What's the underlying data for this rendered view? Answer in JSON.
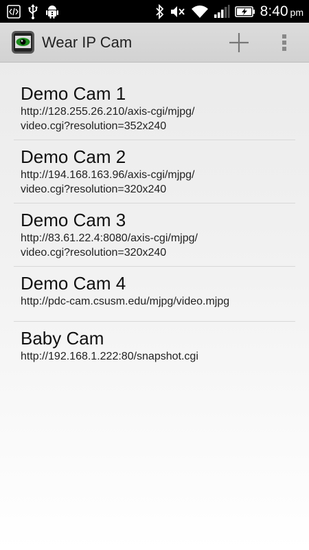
{
  "status_bar": {
    "time": "8:40",
    "ampm": "pm",
    "left_icons": [
      "code-icon",
      "usb-icon",
      "android-debug-icon"
    ],
    "right_icons": [
      "bluetooth-icon",
      "mute-icon",
      "wifi-icon",
      "signal-icon",
      "battery-charging-icon"
    ]
  },
  "action_bar": {
    "title": "Wear IP Cam",
    "add_icon": "plus-icon",
    "overflow_icon": "overflow-menu-icon"
  },
  "cameras": [
    {
      "name": "Demo Cam 1",
      "url": "http://128.255.26.210/axis-cgi/mjpg/\nvideo.cgi?resolution=352x240"
    },
    {
      "name": "Demo Cam 2",
      "url": "http://194.168.163.96/axis-cgi/mjpg/\nvideo.cgi?resolution=320x240"
    },
    {
      "name": "Demo Cam 3",
      "url": "http://83.61.22.4:8080/axis-cgi/mjpg/\nvideo.cgi?resolution=320x240"
    },
    {
      "name": "Demo Cam 4",
      "url": "http://pdc-cam.csusm.edu/mjpg/video.mjpg"
    },
    {
      "name": "Baby Cam",
      "url": "http://192.168.1.222:80/snapshot.cgi"
    }
  ],
  "colors": {
    "status_bar_bg": "#000000",
    "action_bar_bg": "#d6d6d6",
    "app_icon_eye": "#1d8a1d"
  }
}
